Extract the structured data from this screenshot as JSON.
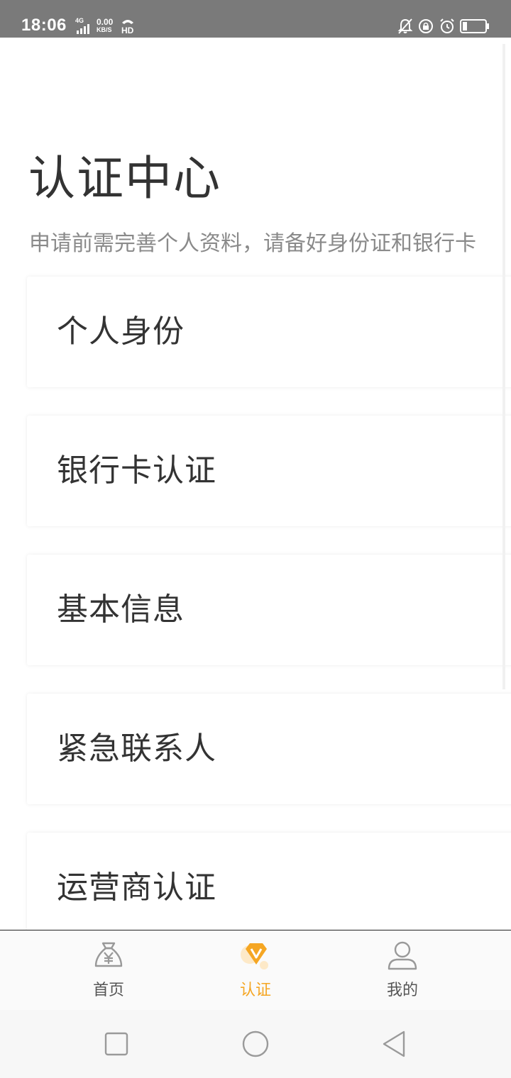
{
  "status_bar": {
    "time": "18:06",
    "network_type": "4G",
    "speed_value": "0.00",
    "speed_unit": "KB/S",
    "hd_label": "HD",
    "icons": [
      "bell-off-icon",
      "rotation-lock-icon",
      "alarm-icon",
      "battery-icon"
    ]
  },
  "page": {
    "title": "认证中心",
    "subtitle": "申请前需完善个人资料，请备好身份证和银行卡"
  },
  "cards": [
    {
      "label": "个人身份"
    },
    {
      "label": "银行卡认证"
    },
    {
      "label": "基本信息"
    },
    {
      "label": "紧急联系人"
    },
    {
      "label": "运营商认证"
    }
  ],
  "tabs": [
    {
      "label": "首页",
      "icon": "money-bag-icon",
      "active": false
    },
    {
      "label": "认证",
      "icon": "diamond-v-icon",
      "active": true
    },
    {
      "label": "我的",
      "icon": "user-icon",
      "active": false
    }
  ],
  "colors": {
    "accent": "#f5a623",
    "status_bar": "#7a7a7a",
    "text": "#333333",
    "subtitle": "#8a8a8a"
  },
  "nav": {
    "icons": [
      "recent-apps-icon",
      "home-icon",
      "back-icon"
    ]
  }
}
